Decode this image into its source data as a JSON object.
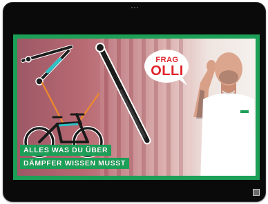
{
  "video": {
    "badge": {
      "line1": "FRAG",
      "line2": "OLLI"
    },
    "caption": {
      "line1": "ALLES WAS DU ÜBER",
      "line2": "DÄMPFER WISSEN MUSST"
    }
  },
  "colors": {
    "frame_green": "#1c9f57",
    "badge_red": "#e1222b",
    "bezel": "#0a0a0a"
  },
  "icons": {
    "fullscreen": "fullscreen-icon",
    "camera": "camera-icon"
  }
}
